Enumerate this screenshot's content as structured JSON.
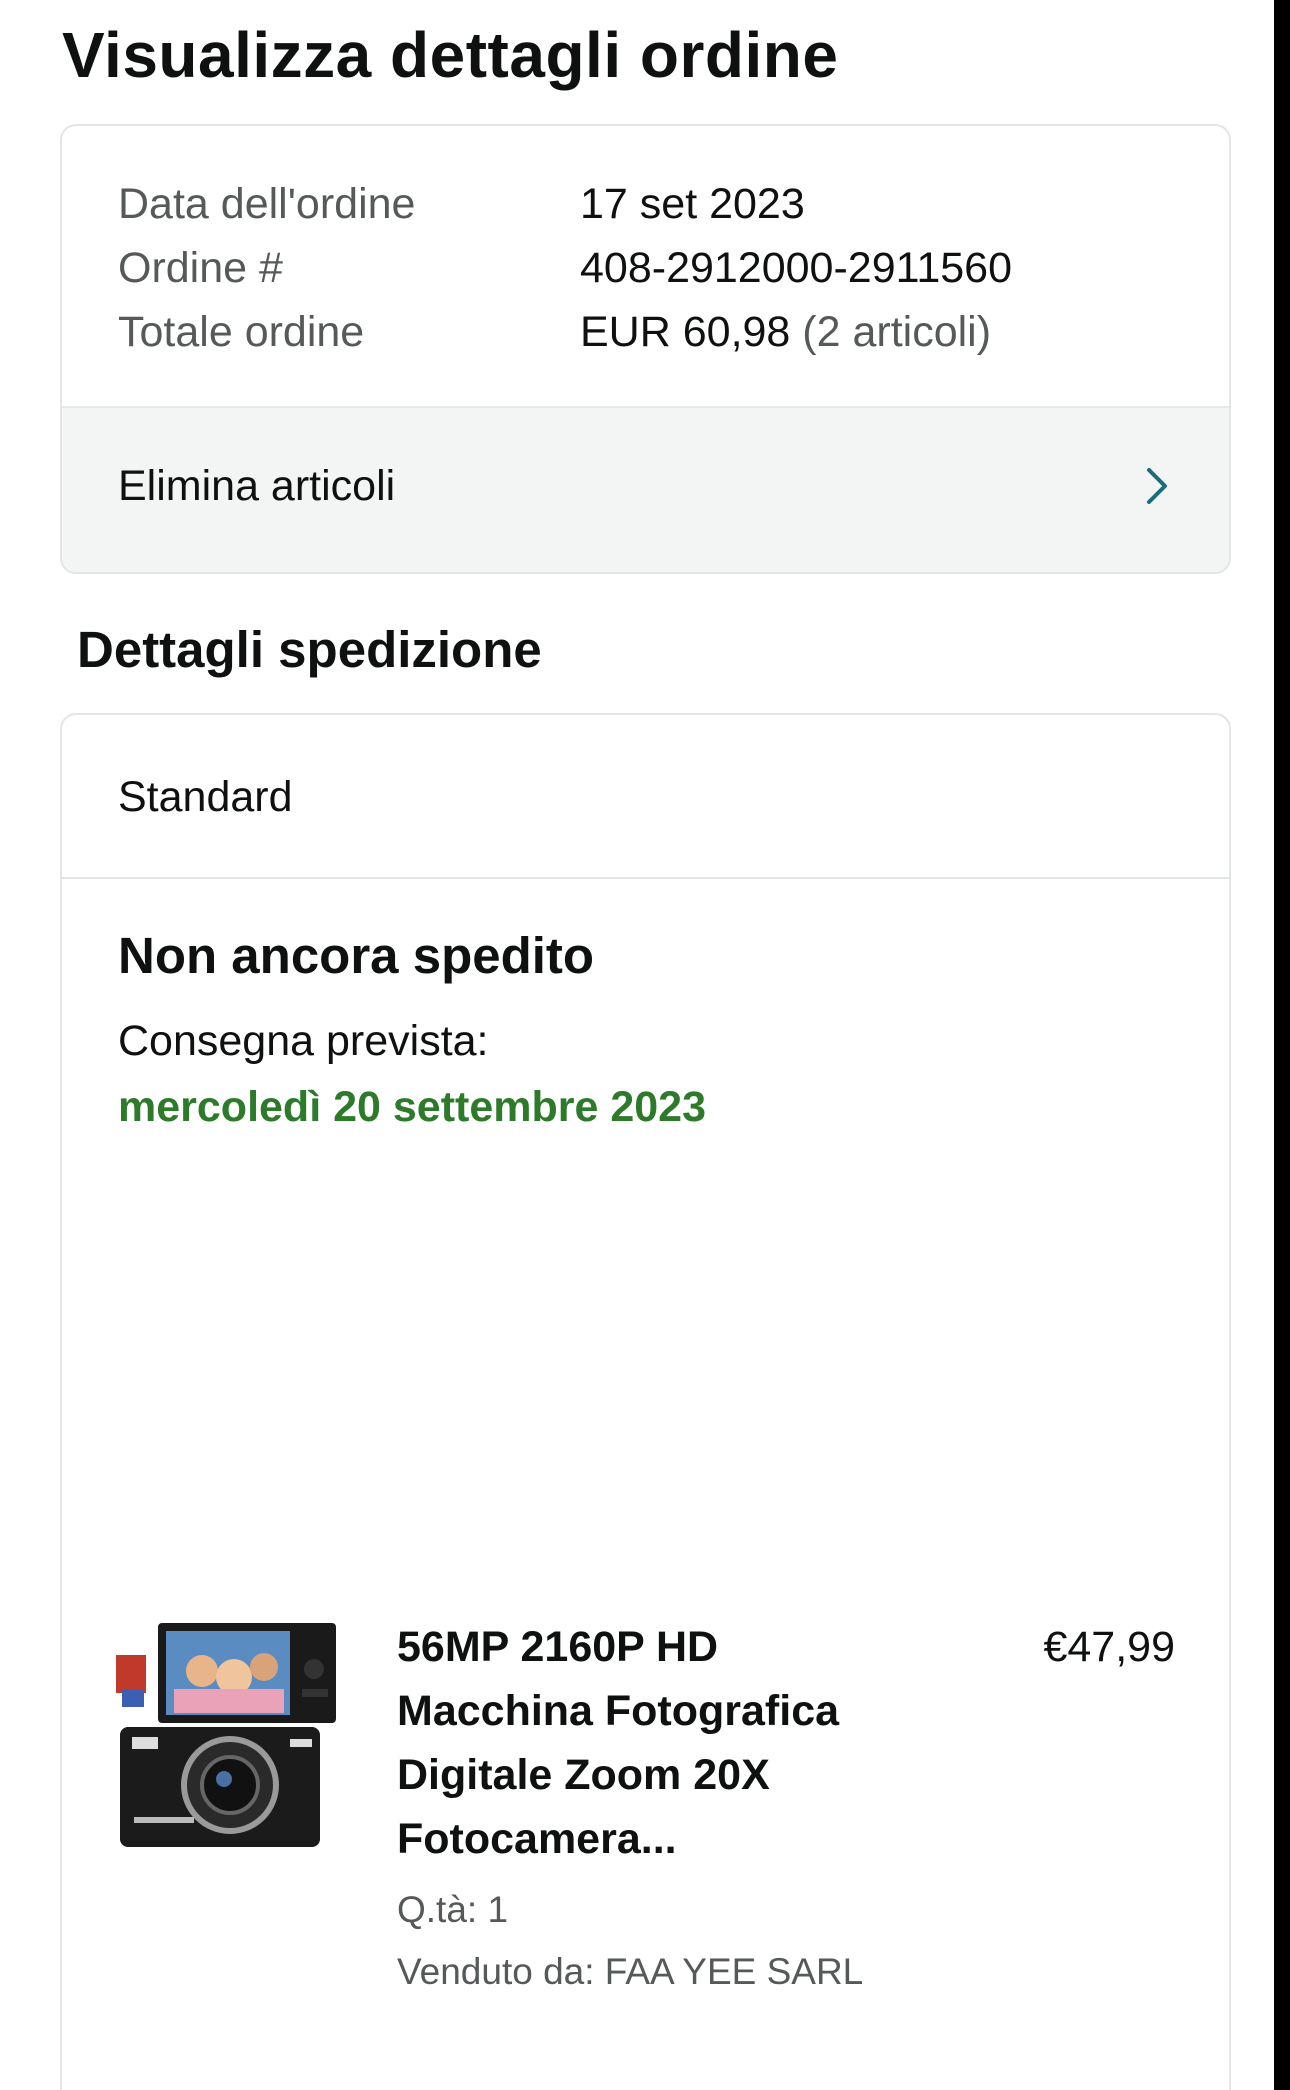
{
  "header": {
    "title": "Visualizza dettagli ordine"
  },
  "order_summary": {
    "date_label": "Data dell'ordine",
    "date_value": "17 set 2023",
    "number_label": "Ordine #",
    "number_value": "408-2912000-2911560",
    "total_label": "Totale ordine",
    "total_value": "EUR 60,98",
    "total_items": "(2 articoli)",
    "delete_items_label": "Elimina articoli"
  },
  "shipping": {
    "section_title": "Dettagli spedizione",
    "method": "Standard",
    "status": "Non ancora spedito",
    "expected_label": "Consegna prevista:",
    "expected_date": "mercoledì 20 settembre 2023",
    "colors": {
      "expected_date": "#2d7a2a"
    }
  },
  "item": {
    "title_lines": [
      "56MP 2160P HD",
      "Macchina Fotografica",
      "Digitale Zoom 20X",
      "Fotocamera..."
    ],
    "price": "€47,99",
    "quantity": "Q.tà: 1",
    "seller": "Venduto da: FAA YEE SARL",
    "thumbnail_icon": "digital-camera-thumbnail"
  }
}
